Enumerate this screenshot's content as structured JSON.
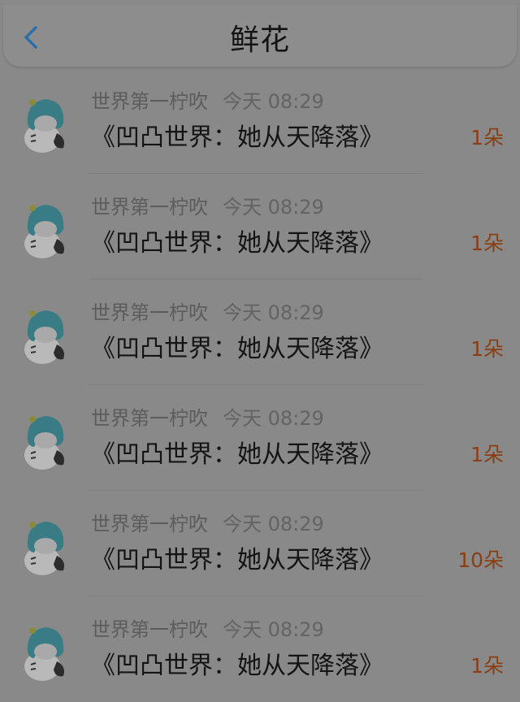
{
  "header": {
    "title": "鲜花",
    "back_icon": "chevron-left-icon",
    "accent_color": "#2d6ea8"
  },
  "gifts": [
    {
      "user": "世界第一柠吹",
      "time": "今天 08:29",
      "book": "《凹凸世界：她从天降落》",
      "amount": "1朵"
    },
    {
      "user": "世界第一柠吹",
      "time": "今天 08:29",
      "book": "《凹凸世界：她从天降落》",
      "amount": "1朵"
    },
    {
      "user": "世界第一柠吹",
      "time": "今天 08:29",
      "book": "《凹凸世界：她从天降落》",
      "amount": "1朵"
    },
    {
      "user": "世界第一柠吹",
      "time": "今天 08:29",
      "book": "《凹凸世界：她从天降落》",
      "amount": "1朵"
    },
    {
      "user": "世界第一柠吹",
      "time": "今天 08:29",
      "book": "《凹凸世界：她从天降落》",
      "amount": "10朵"
    },
    {
      "user": "世界第一柠吹",
      "time": "今天 08:29",
      "book": "《凹凸世界：她从天降落》",
      "amount": "1朵"
    }
  ],
  "colors": {
    "amount": "#8b3e12",
    "avatar_hair": "#3a7c86"
  }
}
